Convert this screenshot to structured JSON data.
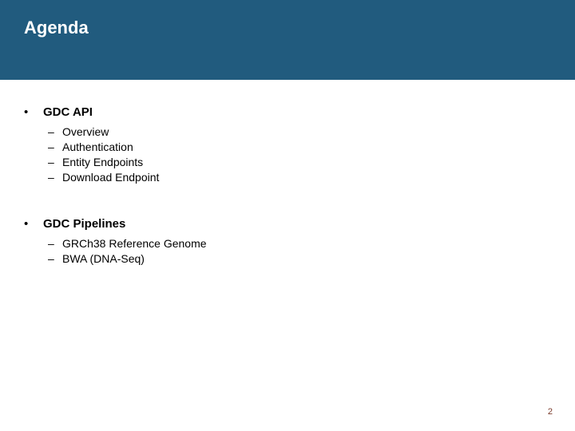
{
  "header": {
    "title": "Agenda"
  },
  "sections": [
    {
      "title": "GDC API",
      "items": [
        "Overview",
        "Authentication",
        "Entity Endpoints",
        "Download Endpoint"
      ]
    },
    {
      "title": "GDC Pipelines",
      "items": [
        "GRCh38 Reference Genome",
        "BWA (DNA-Seq)"
      ]
    }
  ],
  "page_number": "2",
  "bullet_char": "•",
  "dash_char": "–"
}
